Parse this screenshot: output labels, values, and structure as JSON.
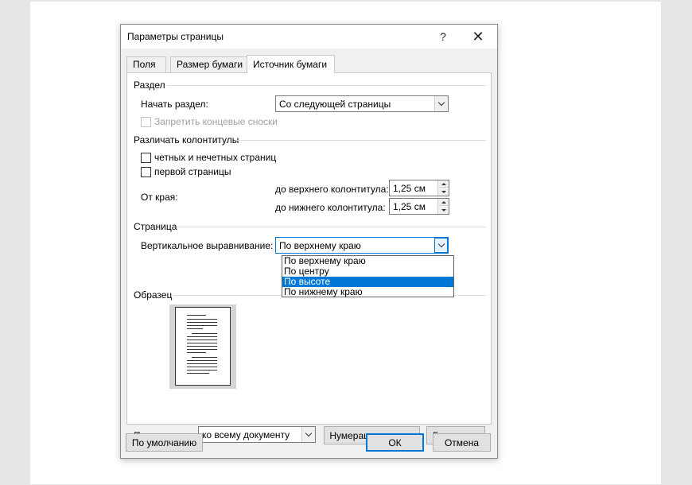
{
  "window": {
    "title": "Параметры страницы",
    "help_glyph": "?",
    "close_glyph": "✕"
  },
  "tabs": [
    {
      "label": "Поля",
      "active": false
    },
    {
      "label": "Размер бумаги",
      "active": false
    },
    {
      "label": "Источник бумаги",
      "active": true
    }
  ],
  "section_razdel": {
    "title": "Раздел",
    "start_label": "Начать раздел:",
    "start_value": "Со следующей страницы",
    "suppress_endnotes_label": "Запретить концевые сноски"
  },
  "section_headers": {
    "title": "Различать колонтитулы",
    "odd_even_label": "четных и нечетных страниц",
    "first_page_label": "первой страницы",
    "from_edge_label": "От края:",
    "header_label": "до верхнего колонтитула:",
    "header_value": "1,25 см",
    "footer_label": "до нижнего колонтитула:",
    "footer_value": "1,25 см"
  },
  "section_page": {
    "title": "Страница",
    "valign_label": "Вертикальное выравнивание:",
    "valign_value": "По верхнему краю",
    "valign_options": [
      "По верхнему краю",
      "По центру",
      "По высоте",
      "По нижнему краю"
    ],
    "valign_highlighted": "По высоте"
  },
  "section_preview": {
    "title": "Образец"
  },
  "apply": {
    "label": "Применить к:",
    "value": "ко всему документу"
  },
  "buttons": {
    "line_numbers": "Нумерация строк...",
    "borders": "Границы...",
    "default": "По умолчанию",
    "ok": "ОК",
    "cancel": "Отмена"
  },
  "colors": {
    "accent": "#0078d7",
    "dialog_bg": "#f0f0f0",
    "disabled_text": "#a0a0a0"
  },
  "icons": {
    "dropdown": "chevron-down-icon",
    "spin_up": "triangle-up-icon",
    "spin_down": "triangle-down-icon"
  }
}
